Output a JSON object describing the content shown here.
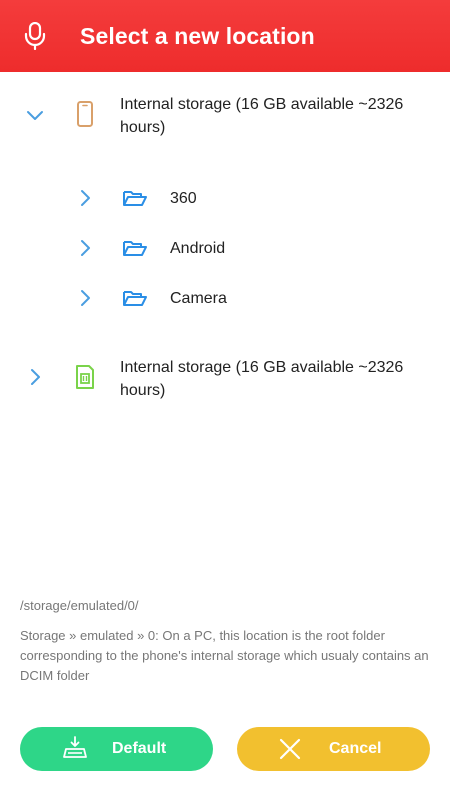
{
  "header": {
    "title": "Select a new location",
    "mic_icon": "microphone-icon",
    "background": "#ee2c2c"
  },
  "tree": {
    "nodes": [
      {
        "label": "Internal storage (16 GB available ~2326 hours)",
        "icon": "phone-icon",
        "expanded": true,
        "children": [
          {
            "label": "360",
            "icon": "folder-open-icon"
          },
          {
            "label": "Android",
            "icon": "folder-open-icon"
          },
          {
            "label": "Camera",
            "icon": "folder-open-icon"
          }
        ]
      },
      {
        "label": "Internal storage (16 GB available ~2326 hours)",
        "icon": "sd-card-icon",
        "expanded": false
      }
    ]
  },
  "info": {
    "path": "/storage/emulated/0/",
    "description": "Storage » emulated » 0: On a PC, this location is the root folder corresponding to the phone's internal storage which usualy contains an DCIM folder"
  },
  "buttons": {
    "default_label": "Default",
    "default_icon": "storage-download-icon",
    "default_color": "#2ed688",
    "cancel_label": "Cancel",
    "cancel_icon": "close-icon",
    "cancel_color": "#f2c02f"
  },
  "colors": {
    "chevron": "#4a9ee0",
    "folder": "#2a8ee6",
    "phone": "#d9a06a",
    "sd_card": "#7ad34a"
  }
}
